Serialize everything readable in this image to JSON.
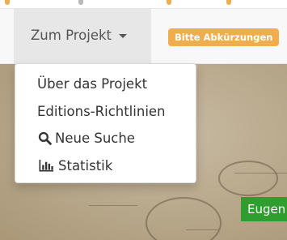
{
  "navbar": {
    "toggle_label": "Zum Projekt",
    "notice_badge": "Bitte Abkürzungen"
  },
  "dropdown": {
    "items": [
      {
        "label": "Über das Projekt",
        "icon": null
      },
      {
        "label": "Editions-Richtlinien",
        "icon": null
      },
      {
        "label": "Neue Suche",
        "icon": "search-icon"
      },
      {
        "label": "Statistik",
        "icon": "bar-chart-icon"
      }
    ]
  },
  "background": {
    "name_label": "Eugen"
  },
  "colors": {
    "badge": "#f0ad4e",
    "name_label": "#2f9e2f",
    "navbar": "#f8f8f8",
    "toggle_active": "#e7e7e7"
  }
}
